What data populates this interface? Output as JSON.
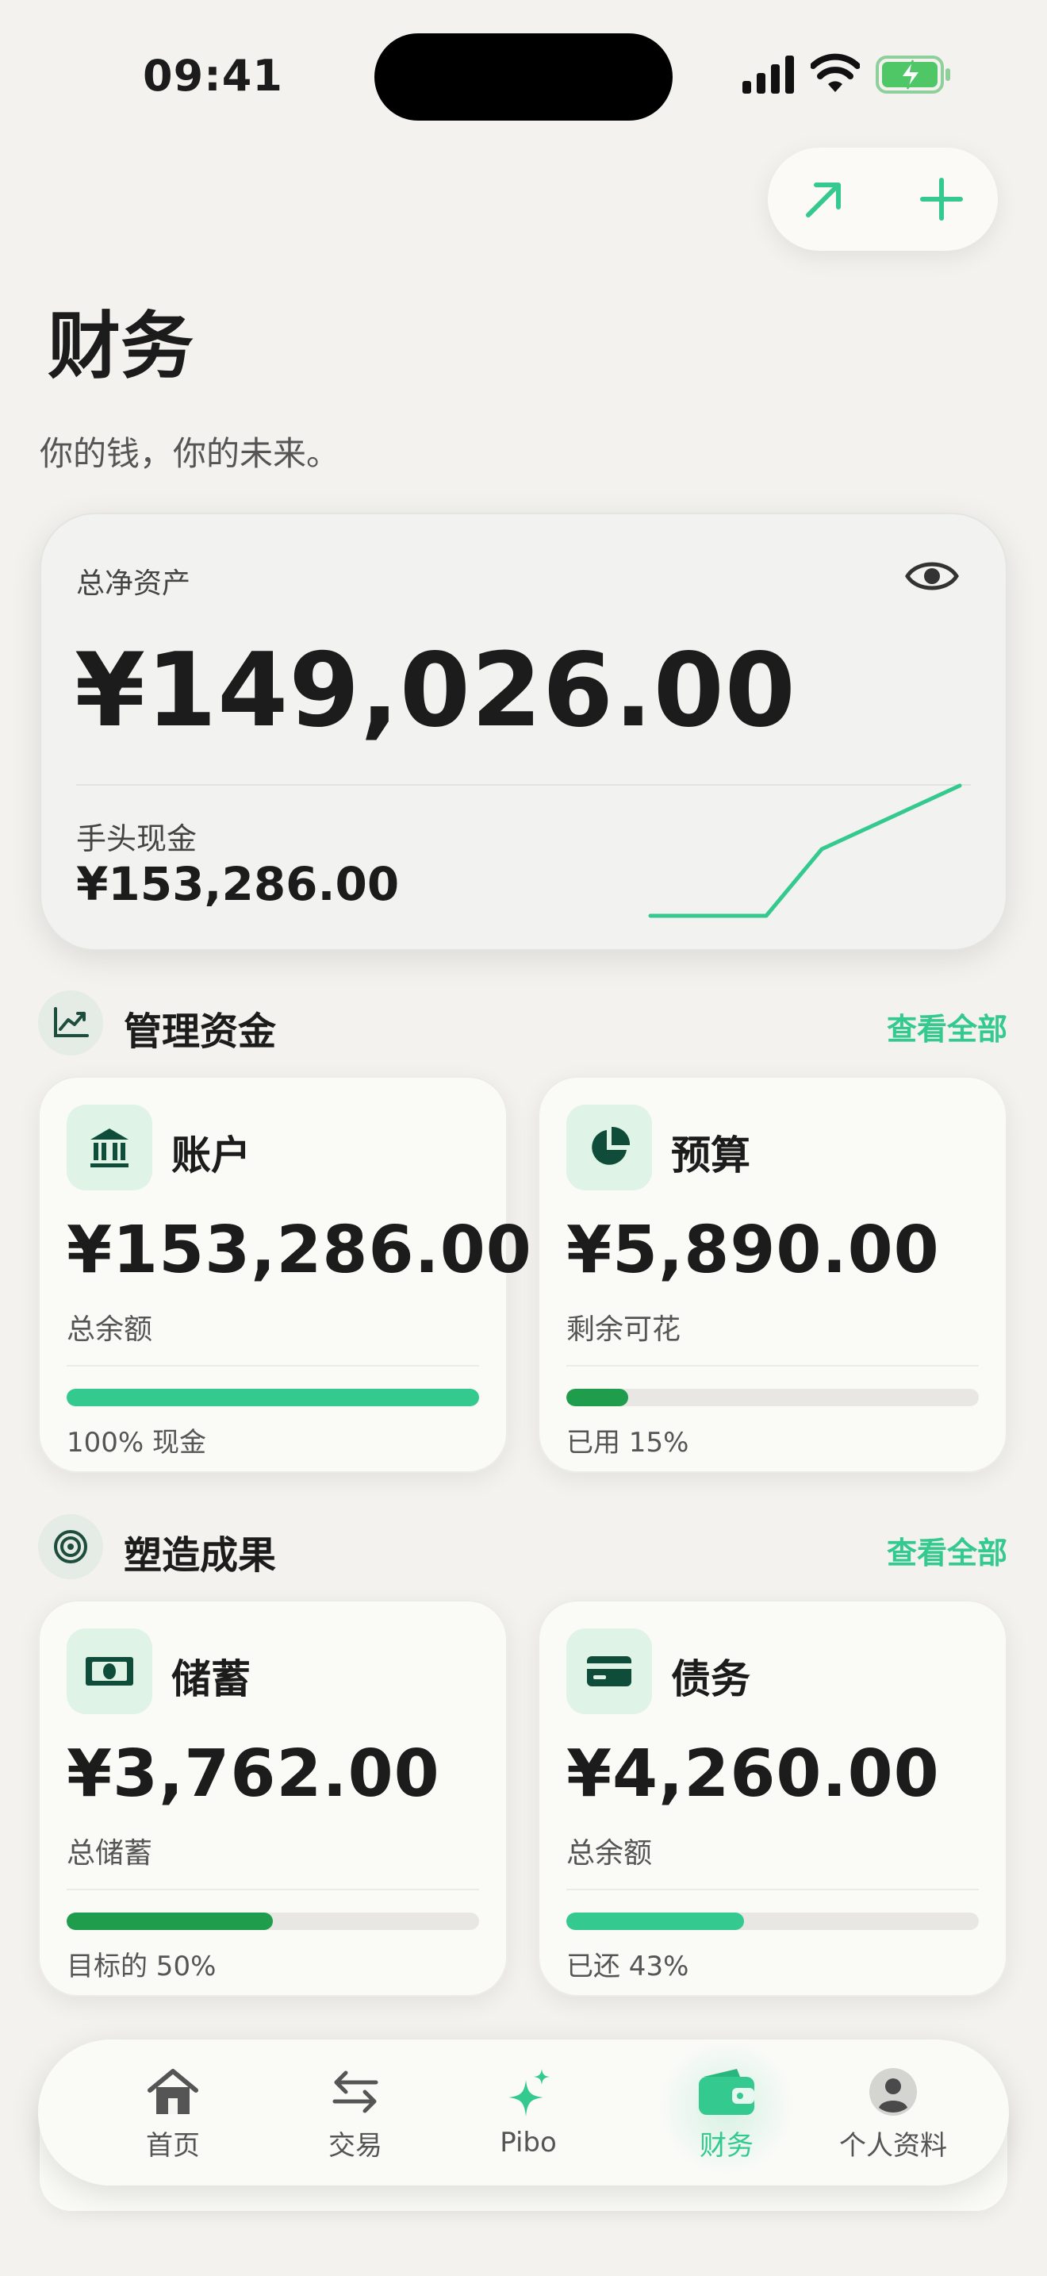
{
  "status": {
    "time": "09:41"
  },
  "header": {
    "title": "财务",
    "subtitle": "你的钱，你的未来。"
  },
  "actions": {
    "open_icon": "arrow-up-right-icon",
    "add_icon": "plus-icon"
  },
  "net_worth": {
    "label": "总净资产",
    "value": "¥149,026.00",
    "cash_label": "手头现金",
    "cash_value": "¥153,286.00"
  },
  "section_manage": {
    "title": "管理资金",
    "link": "查看全部",
    "icon": "trend-chart-icon"
  },
  "accounts": {
    "title": "账户",
    "value": "¥153,286.00",
    "label": "总余额",
    "progress": 100,
    "foot": "100% 现金",
    "color": "#34c98e"
  },
  "budget": {
    "title": "预算",
    "value": "¥5,890.00",
    "label": "剩余可花",
    "progress": 15,
    "foot": "已用 15%",
    "color": "#1f9d4c"
  },
  "section_results": {
    "title": "塑造成果",
    "link": "查看全部",
    "icon": "target-icon"
  },
  "savings": {
    "title": "储蓄",
    "value": "¥3,762.00",
    "label": "总储蓄",
    "progress": 50,
    "foot": "目标的 50%",
    "color": "#1f9d4c"
  },
  "debt": {
    "title": "债务",
    "value": "¥4,260.00",
    "label": "总余额",
    "progress": 43,
    "foot": "已还 43%",
    "color": "#34c98e"
  },
  "tabs": [
    {
      "label": "首页",
      "icon": "home-icon"
    },
    {
      "label": "交易",
      "icon": "swap-arrows-icon"
    },
    {
      "label": "Pibo",
      "icon": "sparkle-icon"
    },
    {
      "label": "财务",
      "icon": "wallet-icon",
      "active": true
    },
    {
      "label": "个人资料",
      "icon": "profile-icon"
    }
  ],
  "colors": {
    "accent": "#34c98e",
    "dark_green": "#0f4d3a",
    "background": "#f3f2ee"
  }
}
